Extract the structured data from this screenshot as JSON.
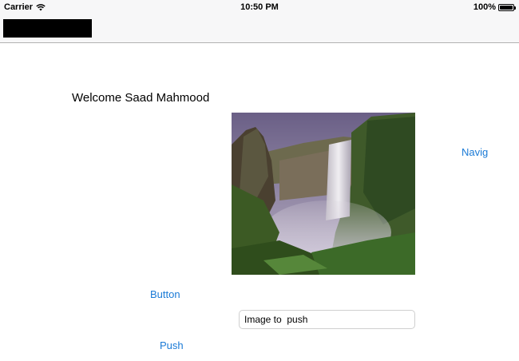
{
  "status_bar": {
    "carrier": "Carrier",
    "time": "10:50 PM",
    "battery": "100%",
    "battery_level": 1.0
  },
  "welcome_text": "Welcome Saad Mahmood",
  "navig_label": "Navig",
  "button_label": "Button",
  "push_label": "Push",
  "text_field": {
    "value": "Image to  push"
  },
  "colors": {
    "link": "#1a7ad6",
    "nav_bar": "#f7f7f8"
  }
}
